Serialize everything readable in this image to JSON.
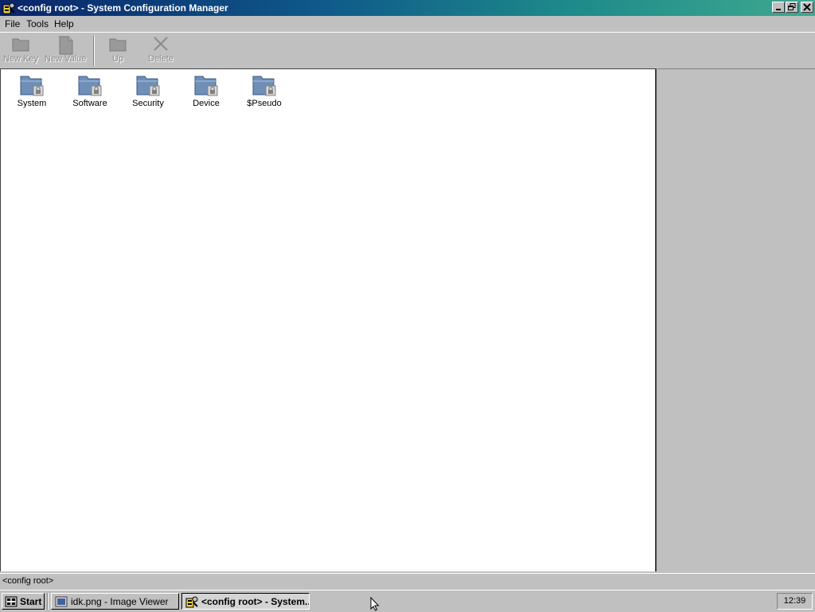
{
  "window": {
    "title": "<config root> - System Configuration Manager",
    "icon": "config-manager-icon"
  },
  "menu": [
    "File",
    "Tools",
    "Help"
  ],
  "toolbar": {
    "new_key": "New Key",
    "new_value": "New Value",
    "up": "Up",
    "delete": "Delete"
  },
  "items": [
    {
      "label": "System",
      "icon": "locked-folder-icon"
    },
    {
      "label": "Software",
      "icon": "locked-folder-icon"
    },
    {
      "label": "Security",
      "icon": "locked-folder-icon"
    },
    {
      "label": "Device",
      "icon": "locked-folder-icon"
    },
    {
      "label": "$Pseudo",
      "icon": "locked-folder-icon"
    }
  ],
  "status": {
    "path": "<config root>"
  },
  "taskbar": {
    "start": "Start",
    "tasks": [
      {
        "label": "idk.png - Image Viewer",
        "active": false
      },
      {
        "label": "<config root> - System...",
        "active": true
      }
    ],
    "clock": "12:39"
  },
  "colors": {
    "titlebar_start": "#0a246a",
    "titlebar_end": "#3fa890",
    "face": "#c0c0c0",
    "disabled_text": "#8a8a8a"
  }
}
